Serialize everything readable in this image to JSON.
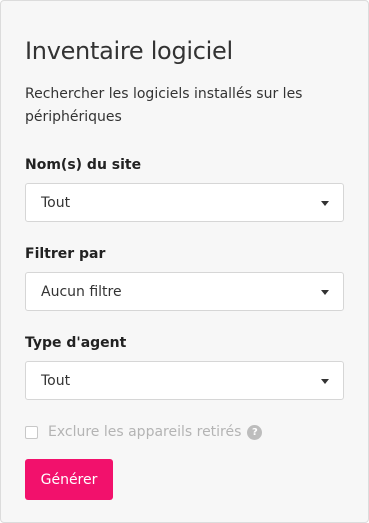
{
  "panel": {
    "title": "Inventaire logiciel",
    "subtitle": "Rechercher les logiciels installés sur les périphériques"
  },
  "fields": {
    "site": {
      "label": "Nom(s) du site",
      "value": "Tout"
    },
    "filter": {
      "label": "Filtrer par",
      "value": "Aucun filtre"
    },
    "agent_type": {
      "label": "Type d'agent",
      "value": "Tout"
    }
  },
  "exclude_retired": {
    "label": "Exclure les appareils retirés",
    "checked": false,
    "help_icon": "question-circle-icon",
    "help_glyph": "?"
  },
  "actions": {
    "generate_label": "Générer"
  },
  "colors": {
    "accent": "#f2116c",
    "panel_bg": "#f7f7f7"
  }
}
